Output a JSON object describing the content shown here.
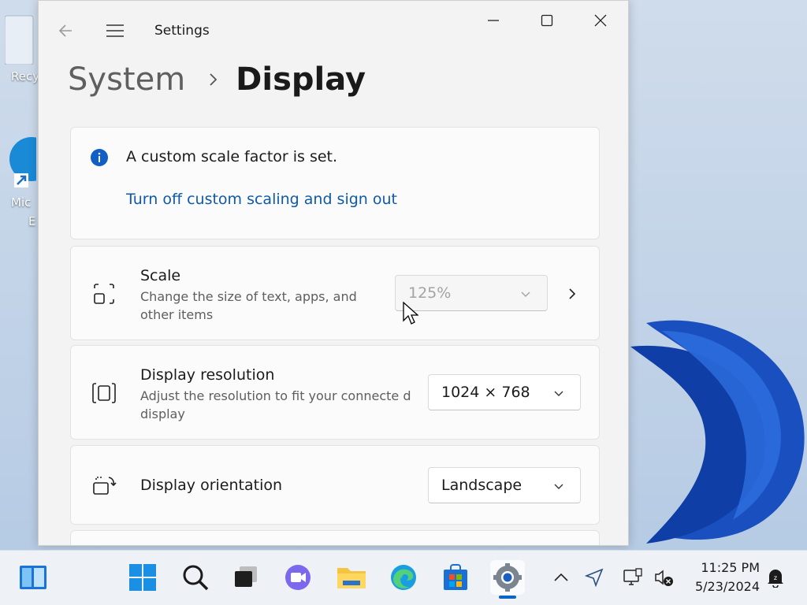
{
  "desktop": {
    "icons": [
      {
        "label": "Recy"
      },
      {
        "label": "Mic"
      },
      {
        "label": "E"
      }
    ]
  },
  "window": {
    "app_title": "Settings",
    "breadcrumb": {
      "parent": "System",
      "current": "Display"
    },
    "info_card": {
      "message": "A custom scale factor is set.",
      "link": "Turn off custom scaling and sign out"
    },
    "scale": {
      "title": "Scale",
      "desc": "Change the size of text, apps, and other items",
      "value": "125%"
    },
    "resolution": {
      "title": "Display resolution",
      "desc": "Adjust the resolution to fit your connecte d display",
      "value": "1024 × 768"
    },
    "orientation": {
      "title": "Display orientation",
      "value": "Landscape"
    }
  },
  "taskbar": {
    "time": "11:25 PM",
    "date": "5/23/2024",
    "accent": "#0a64c8"
  }
}
